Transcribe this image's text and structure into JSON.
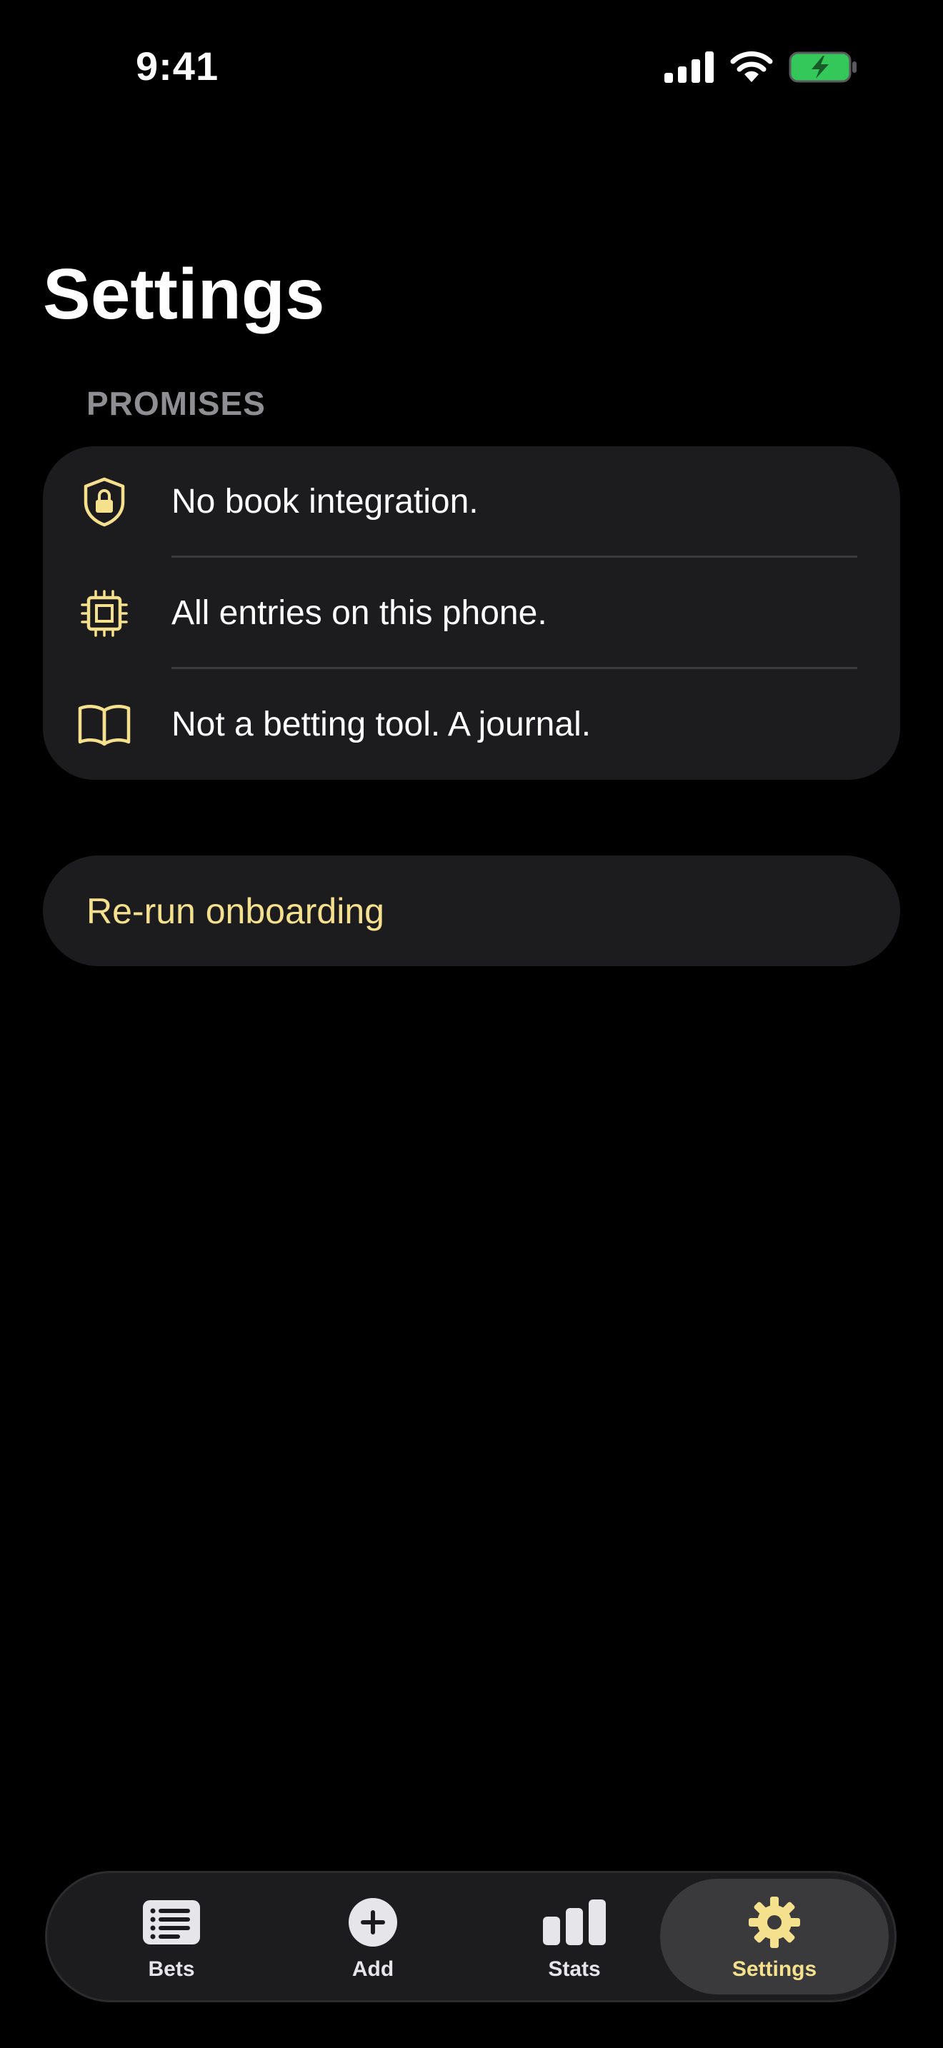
{
  "status_bar": {
    "time": "9:41"
  },
  "page": {
    "title": "Settings"
  },
  "promises": {
    "header": "PROMISES",
    "items": [
      {
        "icon": "shield-lock-icon",
        "label": "No book integration."
      },
      {
        "icon": "chip-icon",
        "label": "All entries on this phone."
      },
      {
        "icon": "book-icon",
        "label": "Not a betting tool. A journal."
      }
    ]
  },
  "onboarding": {
    "label": "Re-run onboarding"
  },
  "tab_bar": {
    "tabs": [
      {
        "icon": "list-icon",
        "label": "Bets"
      },
      {
        "icon": "plus-circle-icon",
        "label": "Add"
      },
      {
        "icon": "bar-chart-icon",
        "label": "Stats"
      },
      {
        "icon": "gear-icon",
        "label": "Settings",
        "active": true
      }
    ]
  },
  "colors": {
    "accent": "#f5e08e",
    "background": "#000000",
    "card": "#1c1c1e",
    "battery": "#34c759"
  }
}
